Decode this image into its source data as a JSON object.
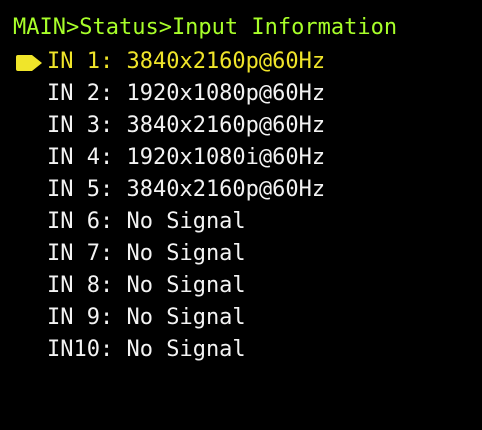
{
  "colors": {
    "background": "#000000",
    "title": "#a8ff2a",
    "selected": "#f0e52a",
    "normal": "#f3f3f3"
  },
  "breadcrumb": "MAIN>Status>Input Information",
  "inputs": [
    {
      "label": "IN 1: 3840x2160p@60Hz",
      "selected": true
    },
    {
      "label": "IN 2: 1920x1080p@60Hz",
      "selected": false
    },
    {
      "label": "IN 3: 3840x2160p@60Hz",
      "selected": false
    },
    {
      "label": "IN 4: 1920x1080i@60Hz",
      "selected": false
    },
    {
      "label": "IN 5: 3840x2160p@60Hz",
      "selected": false
    },
    {
      "label": "IN 6: No Signal",
      "selected": false
    },
    {
      "label": "IN 7: No Signal",
      "selected": false
    },
    {
      "label": "IN 8: No Signal",
      "selected": false
    },
    {
      "label": "IN 9: No Signal",
      "selected": false
    },
    {
      "label": "IN10: No Signal",
      "selected": false
    }
  ],
  "cursor_icon": "selection-arrow-icon"
}
